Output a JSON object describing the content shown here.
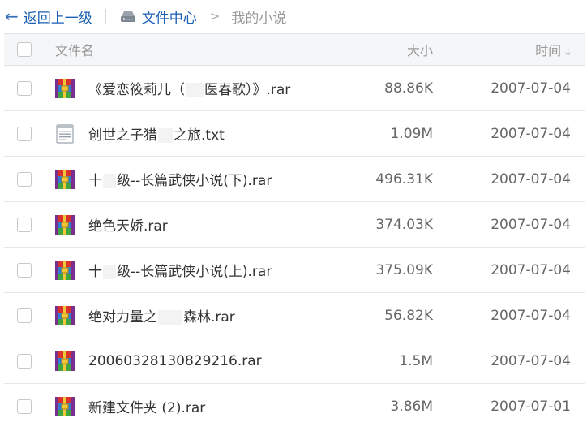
{
  "breadcrumb": {
    "back_label": "返回上一级",
    "root_label": "文件中心",
    "separator": ">",
    "current": "我的小说"
  },
  "columns": {
    "name": "文件名",
    "size": "大小",
    "time": "时间",
    "sort_arrow": "↓"
  },
  "files": [
    {
      "name_a": "《爱恋筱莉儿（",
      "name_b": "医春歌）》.rar",
      "blur_w": 22,
      "size": "88.86K",
      "date": "2007-07-04",
      "icon": "rar-archive-icon"
    },
    {
      "name_a": "创世之子猎",
      "name_b": "之旅.txt",
      "blur_w": 18,
      "size": "1.09M",
      "date": "2007-07-04",
      "icon": "text-file-icon"
    },
    {
      "name_a": "十",
      "name_b": "级--长篇武侠小说(下).rar",
      "blur_w": 16,
      "size": "496.31K",
      "date": "2007-07-04",
      "icon": "rar-archive-icon"
    },
    {
      "name_a": "绝色天娇.rar",
      "name_b": "",
      "blur_w": 0,
      "size": "374.03K",
      "date": "2007-07-04",
      "icon": "rar-archive-icon"
    },
    {
      "name_a": "十",
      "name_b": "级--长篇武侠小说(上).rar",
      "blur_w": 16,
      "size": "375.09K",
      "date": "2007-07-04",
      "icon": "rar-archive-icon"
    },
    {
      "name_a": "绝对力量之",
      "name_b": "森林.rar",
      "blur_w": 30,
      "size": "56.82K",
      "date": "2007-07-04",
      "icon": "rar-archive-icon"
    },
    {
      "name_a": "20060328130829216.rar",
      "name_b": "",
      "blur_w": 0,
      "size": "1.5M",
      "date": "2007-07-04",
      "icon": "rar-archive-icon"
    },
    {
      "name_a": "新建文件夹 (2).rar",
      "name_b": "",
      "blur_w": 0,
      "size": "3.86M",
      "date": "2007-07-01",
      "icon": "rar-archive-icon"
    }
  ]
}
